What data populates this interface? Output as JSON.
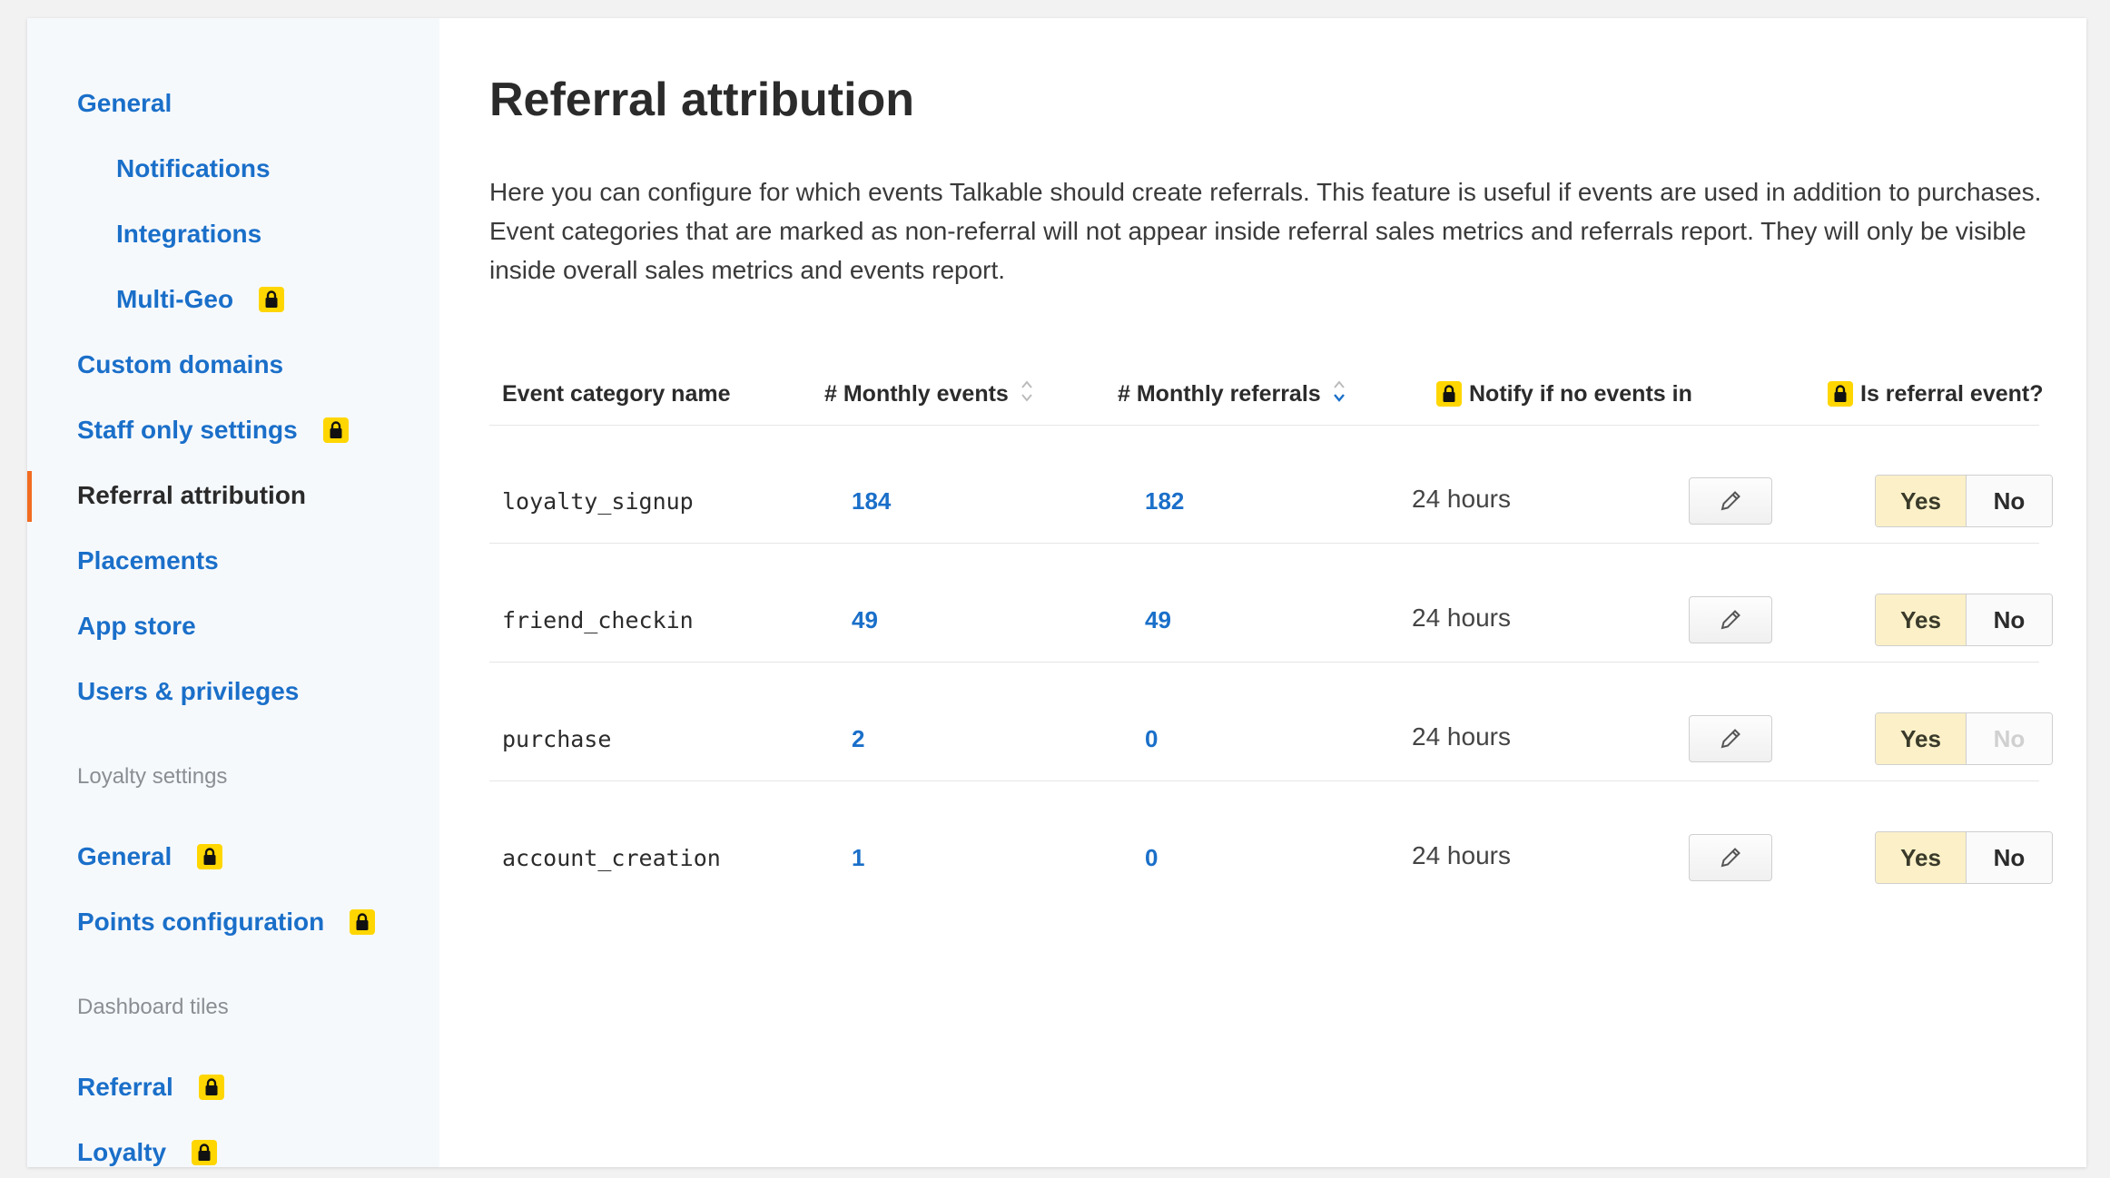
{
  "sidebar": {
    "items": [
      {
        "label": "General",
        "locked": false
      },
      {
        "label": "Notifications",
        "locked": false
      },
      {
        "label": "Integrations",
        "locked": false
      },
      {
        "label": "Multi-Geo",
        "locked": true
      },
      {
        "label": "Custom domains",
        "locked": false
      },
      {
        "label": "Staff only settings",
        "locked": true
      },
      {
        "label": "Referral attribution",
        "locked": false,
        "active": true
      },
      {
        "label": "Placements",
        "locked": false
      },
      {
        "label": "App store",
        "locked": false
      },
      {
        "label": "Users & privileges",
        "locked": false
      }
    ],
    "loyalty_section": {
      "label": "Loyalty settings",
      "items": [
        {
          "label": "General",
          "locked": true
        },
        {
          "label": "Points configuration",
          "locked": true
        }
      ]
    },
    "dashboard_section": {
      "label": "Dashboard tiles",
      "items": [
        {
          "label": "Referral",
          "locked": true
        },
        {
          "label": "Loyalty",
          "locked": true
        }
      ]
    }
  },
  "main": {
    "title": "Referral attribution",
    "intro": "Here you can configure for which events Talkable should create referrals. This feature is useful if events are used in addition to purchases. Event categories that are marked as non-referral will not appear inside referral sales metrics and referrals report. They will only be visible inside overall sales metrics and events report.",
    "table": {
      "headers": {
        "name": "Event category name",
        "monthly_events": "# Monthly events",
        "monthly_referrals": "# Monthly referrals",
        "notify": "Notify if no events in",
        "is_referral": "Is referral event?"
      },
      "rows": [
        {
          "name": "loyalty_signup",
          "monthly_events": "184",
          "monthly_referrals": "182",
          "notify": "24 hours",
          "yes": "Yes",
          "no": "No",
          "no_disabled": false
        },
        {
          "name": "friend_checkin",
          "monthly_events": "49",
          "monthly_referrals": "49",
          "notify": "24 hours",
          "yes": "Yes",
          "no": "No",
          "no_disabled": false
        },
        {
          "name": "purchase",
          "monthly_events": "2",
          "monthly_referrals": "0",
          "notify": "24 hours",
          "yes": "Yes",
          "no": "No",
          "no_disabled": true
        },
        {
          "name": "account_creation",
          "monthly_events": "1",
          "monthly_referrals": "0",
          "notify": "24 hours",
          "yes": "Yes",
          "no": "No",
          "no_disabled": false
        }
      ]
    }
  },
  "colors": {
    "link": "#1a6fc9",
    "active_bar": "#f26b21",
    "lock_badge": "#ffd600",
    "yes_selected": "#fbf0c8"
  },
  "icons": {
    "lock": "lock-icon",
    "edit": "pencil-icon",
    "sort": "sort-icon"
  }
}
